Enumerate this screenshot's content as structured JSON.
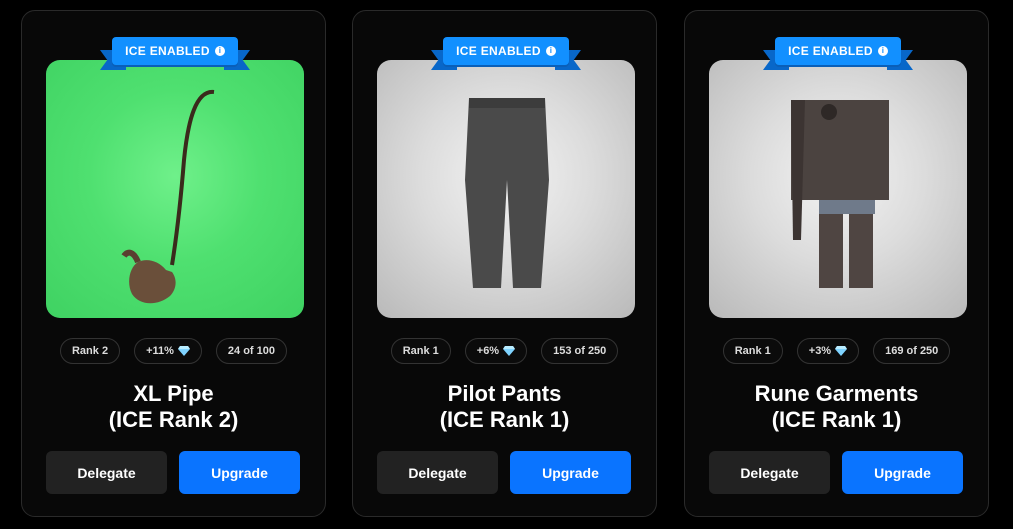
{
  "cards": [
    {
      "ribbon": "ICE ENABLED",
      "image": "xl-pipe-image",
      "chips": {
        "rank": "Rank 2",
        "bonus": "+11%",
        "supply": "24 of 100"
      },
      "title_line1": "XL Pipe",
      "title_line2": "(ICE Rank 2)",
      "delegate_label": "Delegate",
      "upgrade_label": "Upgrade"
    },
    {
      "ribbon": "ICE ENABLED",
      "image": "pilot-pants-image",
      "chips": {
        "rank": "Rank 1",
        "bonus": "+6%",
        "supply": "153 of 250"
      },
      "title_line1": "Pilot Pants",
      "title_line2": "(ICE Rank 1)",
      "delegate_label": "Delegate",
      "upgrade_label": "Upgrade"
    },
    {
      "ribbon": "ICE ENABLED",
      "image": "rune-garments-image",
      "chips": {
        "rank": "Rank 1",
        "bonus": "+3%",
        "supply": "169 of 250"
      },
      "title_line1": "Rune Garments",
      "title_line2": "(ICE Rank 1)",
      "delegate_label": "Delegate",
      "upgrade_label": "Upgrade"
    }
  ],
  "icons": {
    "ribbon_info": "info-icon",
    "bonus": "diamond-icon"
  },
  "colors": {
    "accent": "#0a74ff",
    "ribbon": "#1290ff",
    "card_bg": "#080808"
  }
}
